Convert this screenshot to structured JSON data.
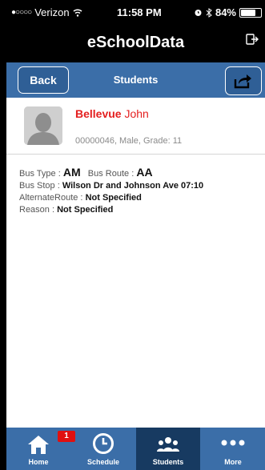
{
  "status_bar": {
    "carrier": "Verizon",
    "time": "11:58 PM",
    "battery_percent": "84%",
    "battery_level": 0.84
  },
  "app": {
    "title": "eSchoolData"
  },
  "nav": {
    "back_label": "Back",
    "title": "Students"
  },
  "student": {
    "last_name": "Bellevue",
    "first_name": "John",
    "info": "00000046, Male, Grade: 11"
  },
  "details": {
    "bus_type_label": "Bus Type : ",
    "bus_type_value": "AM",
    "bus_route_label": "Bus Route : ",
    "bus_route_value": "AA",
    "bus_stop_label": "Bus Stop : ",
    "bus_stop_value": "Wilson Dr and Johnson Ave 07:10",
    "alternate_route_label": "AlternateRoute : ",
    "alternate_route_value": "Not Specified",
    "reason_label": "Reason : ",
    "reason_value": "Not Specified"
  },
  "tabs": [
    {
      "label": "Home",
      "icon": "home-icon",
      "badge": "1"
    },
    {
      "label": "Schedule",
      "icon": "clock-icon"
    },
    {
      "label": "Students",
      "icon": "students-icon",
      "active": true
    },
    {
      "label": "More",
      "icon": "more-icon"
    }
  ],
  "colors": {
    "nav_blue": "#3b6ea8",
    "active_tab": "#173a61",
    "name_red": "#e41e1e",
    "badge_red": "#e01010"
  }
}
